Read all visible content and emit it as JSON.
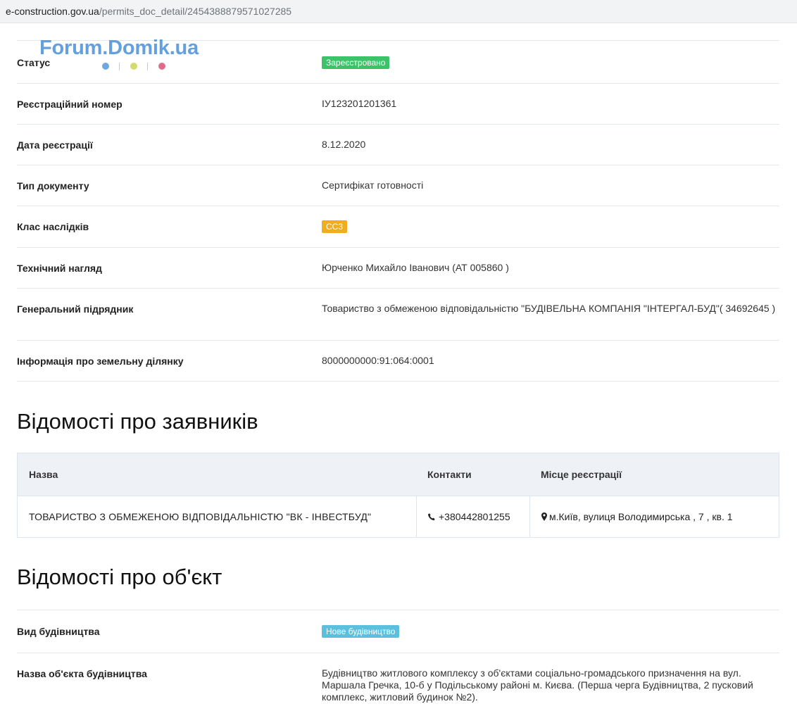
{
  "browser": {
    "url_host": "e-construction.gov.ua",
    "url_path": "/permits_doc_detail/2454388879571027285"
  },
  "watermark": {
    "text": "Forum.Domik.ua",
    "dot_colors": [
      "#6fa8dc",
      "#d3dc6a",
      "#e06c8c"
    ]
  },
  "details": [
    {
      "label": "Статус",
      "value": "Зареєстровано",
      "badge": "green"
    },
    {
      "label": "Реєстраційний номер",
      "value": "ІУ123201201361"
    },
    {
      "label": "Дата реєстрації",
      "value": "8.12.2020"
    },
    {
      "label": "Тип документу",
      "value": "Сертифікат готовності"
    },
    {
      "label": "Клас наслідків",
      "value": "СС3",
      "badge": "orange"
    },
    {
      "label": "Технічний нагляд",
      "value": "Юрченко Михайло Іванович (АТ 005860 )"
    },
    {
      "label": "Генеральний підрядник",
      "value": "Товариство з обмеженою відповідальністю \"БУДІВЕЛЬНА КОМПАНІЯ \"ІНТЕРГАЛ-БУД\"( 34692645 )"
    },
    {
      "label": "Інформація про земельну ділянку",
      "value": "8000000000:91:064:0001"
    }
  ],
  "applicants": {
    "title": "Відомості про заявників",
    "headers": [
      "Назва",
      "Контакти",
      "Місце реєстрації"
    ],
    "rows": [
      {
        "name": "ТОВАРИСТВО З ОБМЕЖЕНОЮ ВІДПОВІДАЛЬНІСТЮ \"ВК - ІНВЕСТБУД\"",
        "phone": "+380442801255",
        "phone_icon": "phone-icon",
        "address": "м.Київ, вулиця Володимирська , 7 , кв. 1",
        "address_icon": "map-marker-icon"
      }
    ]
  },
  "object": {
    "title": "Відомості про об'єкт",
    "rows": [
      {
        "label": "Вид будівництва",
        "value": "Нове будівництво",
        "badge": "blue"
      },
      {
        "label": "Назва об'єкта будівництва",
        "value": "Будівництво житлового комплексу з об'єктами соціально-громадського призначення на вул. Маршала Гречка, 10-б у Подільському районі м. Києва. (Перша черга Будівництва, 2 пусковий комплекс, житловий будинок №2)."
      }
    ]
  },
  "colors": {
    "badge_green": "#3cc36a",
    "badge_orange": "#f0ad1e",
    "badge_blue": "#5bc0de",
    "watermark_text": "#4a90d9"
  }
}
